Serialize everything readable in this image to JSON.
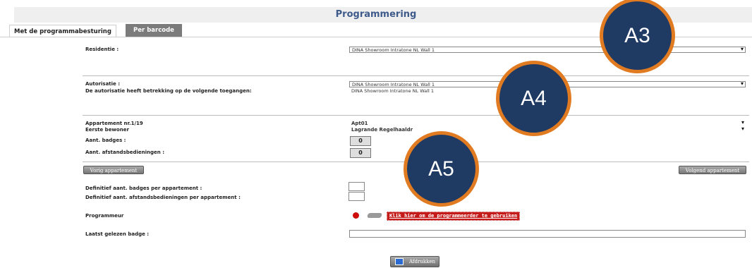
{
  "header": {
    "title": "Programmering"
  },
  "tabs": [
    {
      "label": "Met de programmabesturing"
    },
    {
      "label": "Per barcode"
    }
  ],
  "form": {
    "residentie_label": "Residentie :",
    "residentie_value": "DINA Showroom Intratone NL Wall 1",
    "autorisatie_label": "Autorisatie :",
    "autorisatie_value": "DINA Showroom Intratone NL Wall 1",
    "toegangen_label": "De autorisatie heeft betrekking op de volgende toegangen:",
    "toegangen_value": "DINA Showroom Intratone NL Wall 1",
    "appartement_label": "Appartement nr.1/19",
    "appartement_value": "Apt01",
    "bewoner_label": "Eerste bewoner",
    "bewoner_value": "Lagrande Regelhaaldr",
    "badges_label": "Aant. badges :",
    "badges_value": "0",
    "afstand_label": "Aant. afstandsbedieningen :",
    "afstand_value": "0",
    "prev_button": "Vorig appartement",
    "next_button": "Volgend appartement",
    "def_badges_label": "Definitief aant. badges per appartement :",
    "def_afstand_label": "Definitief aant. afstandsbedieningen per appartement :",
    "programmeur_label": "Programmeur",
    "programmeur_link": "Klik hier om de programmeerder te gebruiken",
    "laatst_label": "Laatst gelezen badge :",
    "print_button": "Afdrukken"
  },
  "callouts": [
    {
      "label": "A3"
    },
    {
      "label": "A4"
    },
    {
      "label": "A5"
    }
  ],
  "colors": {
    "accent": "#3d5a8a",
    "callout_fill": "#1f3a63",
    "callout_ring": "#e07b22",
    "link_red": "#c41a1a"
  },
  "icons": {
    "print": "printer-icon",
    "status": "red-dot-icon",
    "reader": "badge-reader-icon"
  }
}
